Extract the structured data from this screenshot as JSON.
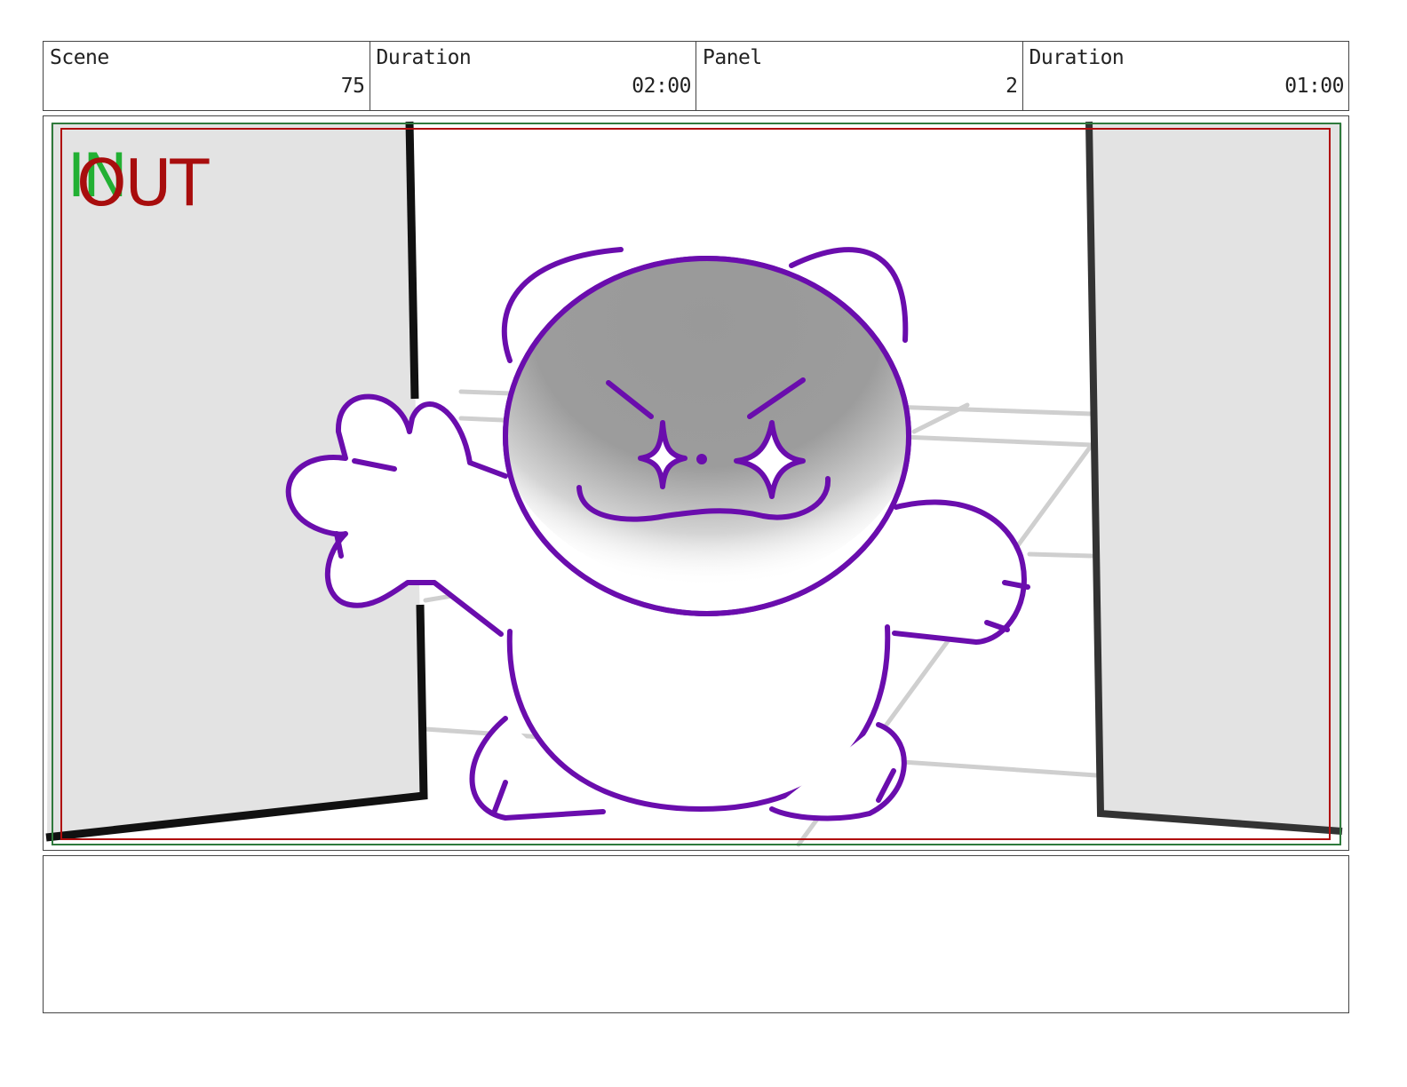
{
  "header": {
    "cells": [
      {
        "label": "Scene",
        "value": "75"
      },
      {
        "label": "Duration",
        "value": "02:00"
      },
      {
        "label": "Panel",
        "value": "2"
      },
      {
        "label": "Duration",
        "value": "01:00"
      }
    ]
  },
  "panel": {
    "markers": {
      "in": "IN",
      "out": "OUT"
    },
    "colors": {
      "in_marker": "#22b033",
      "out_marker": "#a80d0d",
      "character_outline": "#6a0dad",
      "door_fill": "#e3e3e3",
      "head_shade": "#9a9a9a"
    }
  },
  "notes": {
    "text": ""
  }
}
